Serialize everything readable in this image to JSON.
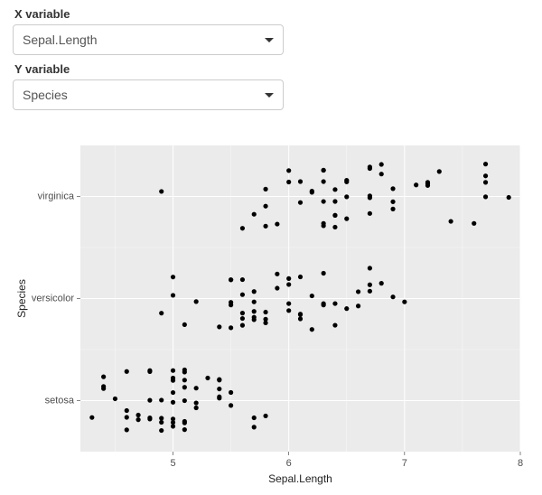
{
  "controls": {
    "x": {
      "label": "X variable",
      "value": "Sepal.Length"
    },
    "y": {
      "label": "Y variable",
      "value": "Species"
    }
  },
  "chart_data": {
    "type": "scatter",
    "xlabel": "Sepal.Length",
    "ylabel": "Species",
    "xlim": [
      4.2,
      8.0
    ],
    "x_ticks": [
      5,
      6,
      7,
      8
    ],
    "categories": [
      "setosa",
      "versicolor",
      "virginica"
    ],
    "jitter": 0.32,
    "series": [
      {
        "name": "setosa",
        "x": [
          5.1,
          4.9,
          4.7,
          4.6,
          5.0,
          5.4,
          4.6,
          5.0,
          4.4,
          4.9,
          5.4,
          4.8,
          4.8,
          4.3,
          5.8,
          5.7,
          5.4,
          5.1,
          5.7,
          5.1,
          5.4,
          5.1,
          4.6,
          5.1,
          4.8,
          5.0,
          5.0,
          5.2,
          5.2,
          4.7,
          4.8,
          5.4,
          5.2,
          5.5,
          4.9,
          5.0,
          5.5,
          4.9,
          4.4,
          5.1,
          5.0,
          4.5,
          4.4,
          5.0,
          5.1,
          4.8,
          5.1,
          4.6,
          5.3,
          5.0
        ]
      },
      {
        "name": "versicolor",
        "x": [
          7.0,
          6.4,
          6.9,
          5.5,
          6.5,
          5.7,
          6.3,
          4.9,
          6.6,
          5.2,
          5.0,
          5.9,
          6.0,
          6.1,
          5.6,
          6.7,
          5.6,
          5.8,
          6.2,
          5.6,
          5.9,
          6.1,
          6.3,
          6.1,
          6.4,
          6.6,
          6.8,
          6.7,
          6.0,
          5.7,
          5.5,
          5.5,
          5.8,
          6.0,
          5.4,
          6.0,
          6.7,
          6.3,
          5.6,
          5.5,
          5.5,
          6.1,
          5.8,
          5.0,
          5.6,
          5.7,
          5.7,
          6.2,
          5.1,
          5.7
        ]
      },
      {
        "name": "virginica",
        "x": [
          6.3,
          5.8,
          7.1,
          6.3,
          6.5,
          7.6,
          4.9,
          7.3,
          6.7,
          7.2,
          6.5,
          6.4,
          6.8,
          5.7,
          5.8,
          6.4,
          6.5,
          7.7,
          7.7,
          6.0,
          6.9,
          5.6,
          7.7,
          6.3,
          6.7,
          7.2,
          6.2,
          6.1,
          6.4,
          7.2,
          7.4,
          7.9,
          6.4,
          6.3,
          6.1,
          7.7,
          6.3,
          6.4,
          6.0,
          6.9,
          6.7,
          6.9,
          5.8,
          6.8,
          6.7,
          6.7,
          6.3,
          6.5,
          6.2,
          5.9
        ]
      }
    ]
  }
}
